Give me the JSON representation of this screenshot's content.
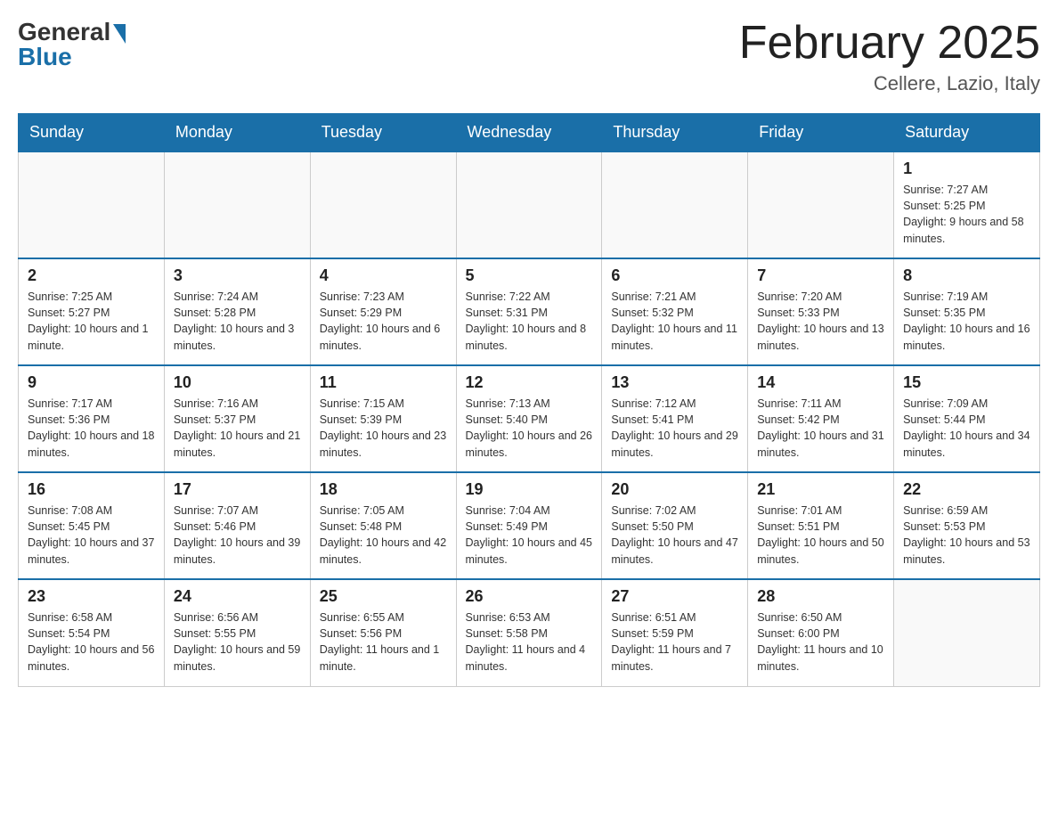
{
  "header": {
    "logo_general": "General",
    "logo_blue": "Blue",
    "month_title": "February 2025",
    "subtitle": "Cellere, Lazio, Italy"
  },
  "days_of_week": [
    "Sunday",
    "Monday",
    "Tuesday",
    "Wednesday",
    "Thursday",
    "Friday",
    "Saturday"
  ],
  "weeks": [
    [
      {
        "day": "",
        "sunrise": "",
        "sunset": "",
        "daylight": ""
      },
      {
        "day": "",
        "sunrise": "",
        "sunset": "",
        "daylight": ""
      },
      {
        "day": "",
        "sunrise": "",
        "sunset": "",
        "daylight": ""
      },
      {
        "day": "",
        "sunrise": "",
        "sunset": "",
        "daylight": ""
      },
      {
        "day": "",
        "sunrise": "",
        "sunset": "",
        "daylight": ""
      },
      {
        "day": "",
        "sunrise": "",
        "sunset": "",
        "daylight": ""
      },
      {
        "day": "1",
        "sunrise": "Sunrise: 7:27 AM",
        "sunset": "Sunset: 5:25 PM",
        "daylight": "Daylight: 9 hours and 58 minutes."
      }
    ],
    [
      {
        "day": "2",
        "sunrise": "Sunrise: 7:25 AM",
        "sunset": "Sunset: 5:27 PM",
        "daylight": "Daylight: 10 hours and 1 minute."
      },
      {
        "day": "3",
        "sunrise": "Sunrise: 7:24 AM",
        "sunset": "Sunset: 5:28 PM",
        "daylight": "Daylight: 10 hours and 3 minutes."
      },
      {
        "day": "4",
        "sunrise": "Sunrise: 7:23 AM",
        "sunset": "Sunset: 5:29 PM",
        "daylight": "Daylight: 10 hours and 6 minutes."
      },
      {
        "day": "5",
        "sunrise": "Sunrise: 7:22 AM",
        "sunset": "Sunset: 5:31 PM",
        "daylight": "Daylight: 10 hours and 8 minutes."
      },
      {
        "day": "6",
        "sunrise": "Sunrise: 7:21 AM",
        "sunset": "Sunset: 5:32 PM",
        "daylight": "Daylight: 10 hours and 11 minutes."
      },
      {
        "day": "7",
        "sunrise": "Sunrise: 7:20 AM",
        "sunset": "Sunset: 5:33 PM",
        "daylight": "Daylight: 10 hours and 13 minutes."
      },
      {
        "day": "8",
        "sunrise": "Sunrise: 7:19 AM",
        "sunset": "Sunset: 5:35 PM",
        "daylight": "Daylight: 10 hours and 16 minutes."
      }
    ],
    [
      {
        "day": "9",
        "sunrise": "Sunrise: 7:17 AM",
        "sunset": "Sunset: 5:36 PM",
        "daylight": "Daylight: 10 hours and 18 minutes."
      },
      {
        "day": "10",
        "sunrise": "Sunrise: 7:16 AM",
        "sunset": "Sunset: 5:37 PM",
        "daylight": "Daylight: 10 hours and 21 minutes."
      },
      {
        "day": "11",
        "sunrise": "Sunrise: 7:15 AM",
        "sunset": "Sunset: 5:39 PM",
        "daylight": "Daylight: 10 hours and 23 minutes."
      },
      {
        "day": "12",
        "sunrise": "Sunrise: 7:13 AM",
        "sunset": "Sunset: 5:40 PM",
        "daylight": "Daylight: 10 hours and 26 minutes."
      },
      {
        "day": "13",
        "sunrise": "Sunrise: 7:12 AM",
        "sunset": "Sunset: 5:41 PM",
        "daylight": "Daylight: 10 hours and 29 minutes."
      },
      {
        "day": "14",
        "sunrise": "Sunrise: 7:11 AM",
        "sunset": "Sunset: 5:42 PM",
        "daylight": "Daylight: 10 hours and 31 minutes."
      },
      {
        "day": "15",
        "sunrise": "Sunrise: 7:09 AM",
        "sunset": "Sunset: 5:44 PM",
        "daylight": "Daylight: 10 hours and 34 minutes."
      }
    ],
    [
      {
        "day": "16",
        "sunrise": "Sunrise: 7:08 AM",
        "sunset": "Sunset: 5:45 PM",
        "daylight": "Daylight: 10 hours and 37 minutes."
      },
      {
        "day": "17",
        "sunrise": "Sunrise: 7:07 AM",
        "sunset": "Sunset: 5:46 PM",
        "daylight": "Daylight: 10 hours and 39 minutes."
      },
      {
        "day": "18",
        "sunrise": "Sunrise: 7:05 AM",
        "sunset": "Sunset: 5:48 PM",
        "daylight": "Daylight: 10 hours and 42 minutes."
      },
      {
        "day": "19",
        "sunrise": "Sunrise: 7:04 AM",
        "sunset": "Sunset: 5:49 PM",
        "daylight": "Daylight: 10 hours and 45 minutes."
      },
      {
        "day": "20",
        "sunrise": "Sunrise: 7:02 AM",
        "sunset": "Sunset: 5:50 PM",
        "daylight": "Daylight: 10 hours and 47 minutes."
      },
      {
        "day": "21",
        "sunrise": "Sunrise: 7:01 AM",
        "sunset": "Sunset: 5:51 PM",
        "daylight": "Daylight: 10 hours and 50 minutes."
      },
      {
        "day": "22",
        "sunrise": "Sunrise: 6:59 AM",
        "sunset": "Sunset: 5:53 PM",
        "daylight": "Daylight: 10 hours and 53 minutes."
      }
    ],
    [
      {
        "day": "23",
        "sunrise": "Sunrise: 6:58 AM",
        "sunset": "Sunset: 5:54 PM",
        "daylight": "Daylight: 10 hours and 56 minutes."
      },
      {
        "day": "24",
        "sunrise": "Sunrise: 6:56 AM",
        "sunset": "Sunset: 5:55 PM",
        "daylight": "Daylight: 10 hours and 59 minutes."
      },
      {
        "day": "25",
        "sunrise": "Sunrise: 6:55 AM",
        "sunset": "Sunset: 5:56 PM",
        "daylight": "Daylight: 11 hours and 1 minute."
      },
      {
        "day": "26",
        "sunrise": "Sunrise: 6:53 AM",
        "sunset": "Sunset: 5:58 PM",
        "daylight": "Daylight: 11 hours and 4 minutes."
      },
      {
        "day": "27",
        "sunrise": "Sunrise: 6:51 AM",
        "sunset": "Sunset: 5:59 PM",
        "daylight": "Daylight: 11 hours and 7 minutes."
      },
      {
        "day": "28",
        "sunrise": "Sunrise: 6:50 AM",
        "sunset": "Sunset: 6:00 PM",
        "daylight": "Daylight: 11 hours and 10 minutes."
      },
      {
        "day": "",
        "sunrise": "",
        "sunset": "",
        "daylight": ""
      }
    ]
  ]
}
